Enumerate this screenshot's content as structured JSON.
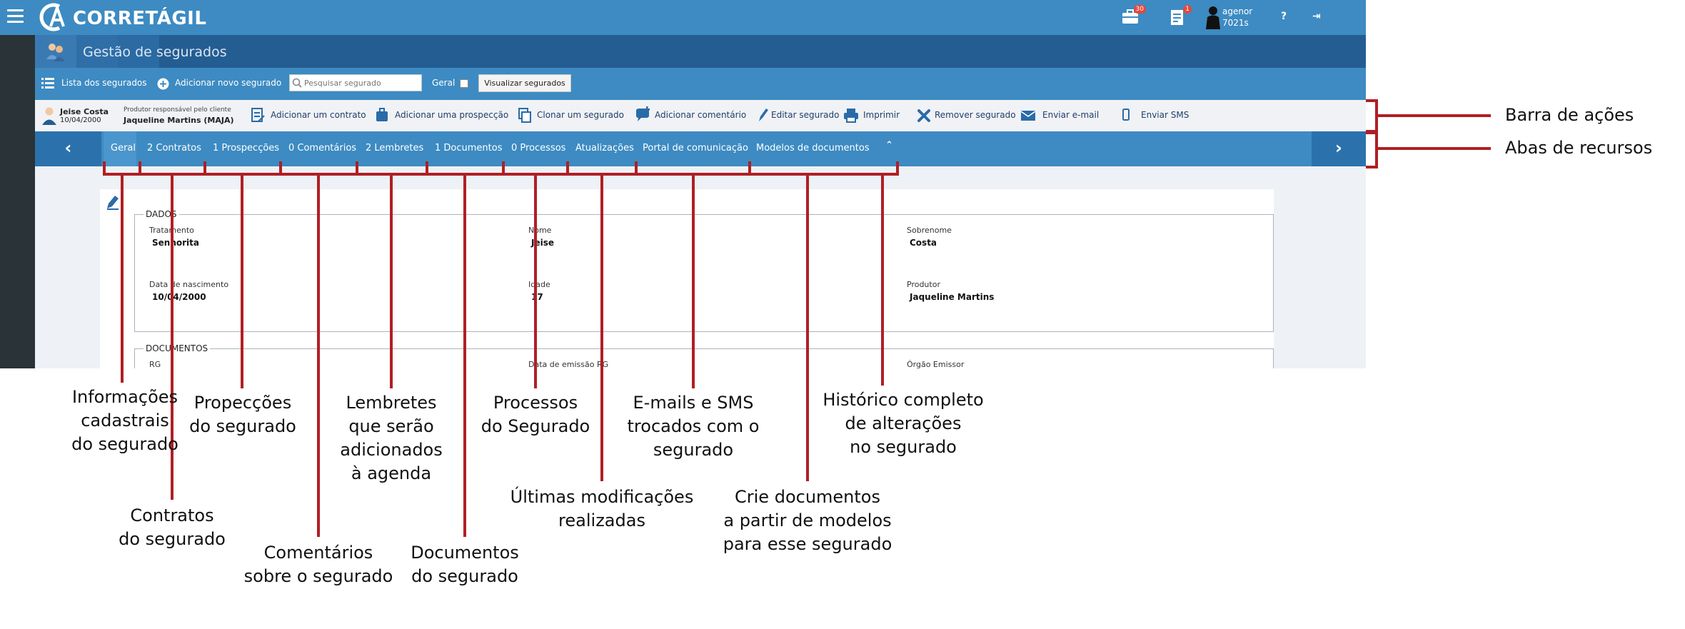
{
  "app": {
    "brand": "CORRETÁGIL",
    "notifications": {
      "briefcase_count": "30",
      "list_count": "1"
    },
    "user": {
      "line1": "agenor",
      "line2": "7021s"
    },
    "help_glyph": "?",
    "logout_glyph": "⇥"
  },
  "module": {
    "title": "Gestão de segurados"
  },
  "toolbar": {
    "list_label": "Lista dos segurados",
    "add_label": "Adicionar novo segurado",
    "search_placeholder": "Pesquisar segurado",
    "geral_label": "Geral",
    "visualizar_label": "Visualizar segurados"
  },
  "client": {
    "name": "Jeise Costa",
    "birth": "10/04/2000",
    "producer_label": "Produtor responsável pelo cliente",
    "producer_value": "Jaqueline Martins (MAJA)"
  },
  "actions": {
    "add_contract": "Adicionar um contrato",
    "add_prospect": "Adicionar uma prospecção",
    "clone": "Clonar um segurado",
    "add_comment": "Adicionar comentário",
    "edit": "Editar segurado",
    "print": "Imprimir",
    "remove": "Remover segurado",
    "email": "Enviar e-mail",
    "sms": "Enviar SMS"
  },
  "tabs": {
    "geral": "Geral",
    "contratos": "2 Contratos",
    "prospeccoes": "1 Prospecções",
    "comentarios": "0 Comentários",
    "lembretes": "2 Lembretes",
    "documentos": "1 Documentos",
    "processos": "0 Processos",
    "atualizacoes": "Atualizações",
    "portal": "Portal de comunicação",
    "modelos": "Modelos de documentos",
    "prev": "‹",
    "next": "›",
    "collapse": "⌃"
  },
  "dados": {
    "legend": "DADOS",
    "tratamento_label": "Tratamento",
    "tratamento_value": "Senhorita",
    "nome_label": "Nome",
    "nome_value": "Jeise",
    "sobrenome_label": "Sobrenome",
    "sobrenome_value": "Costa",
    "nascimento_label": "Data de nascimento",
    "nascimento_value": "10/04/2000",
    "idade_label": "Idade",
    "idade_value": "17",
    "produtor_label": "Produtor",
    "produtor_value": "Jaqueline Martins"
  },
  "documentos": {
    "legend": "DOCUMENTOS",
    "rg_label": "RG",
    "emissao_label": "Data de emissão RG",
    "orgao_label": "Órgão Emissor"
  },
  "annotations": {
    "barra_acoes": "Barra de ações",
    "abas_recursos": "Abas de recursos",
    "informacoes": [
      "Informações",
      "cadastrais",
      "do segurado"
    ],
    "propeccoes": [
      "Propecções",
      "do segurado"
    ],
    "lembretes": [
      "Lembretes",
      "que serão",
      "adicionados",
      "à agenda"
    ],
    "processos": [
      "Processos",
      "do Segurado"
    ],
    "emails": [
      "E-mails e SMS",
      "trocados com o",
      "segurado"
    ],
    "historico": [
      "Histórico completo",
      "de alterações",
      "no segurado"
    ],
    "contratos": [
      "Contratos",
      "do segurado"
    ],
    "comentarios": [
      "Comentários",
      "sobre o segurado"
    ],
    "documentos": [
      "Documentos",
      "do segurado"
    ],
    "ultimas": [
      "Últimas modificações",
      "realizadas"
    ],
    "crie": [
      "Crie documentos",
      "a partir de modelos",
      "para esse segurado"
    ]
  },
  "colors": {
    "topbar": "#3d8bc2",
    "module_bar": "#245d92",
    "sidebar": "#2a3337",
    "annotation_red": "#b01f24"
  }
}
